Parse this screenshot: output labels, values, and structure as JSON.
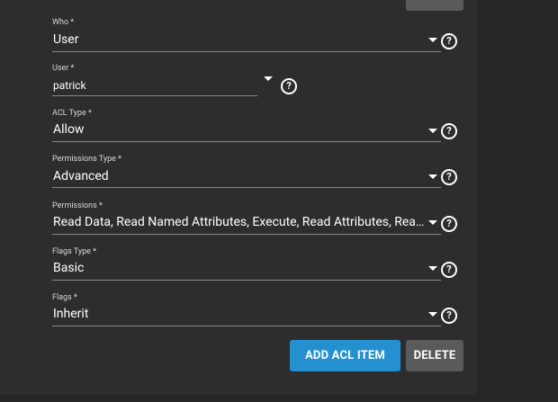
{
  "fields": [
    {
      "label": "Who *",
      "value": "User"
    },
    {
      "label": "User *",
      "value": "patrick"
    },
    {
      "label": "ACL Type *",
      "value": "Allow"
    },
    {
      "label": "Permissions Type *",
      "value": "Advanced"
    },
    {
      "label": "Permissions *",
      "value": "Read Data, Read Named Attributes, Execute, Read Attributes, Rea…"
    },
    {
      "label": "Flags Type *",
      "value": "Basic"
    },
    {
      "label": "Flags *",
      "value": "Inherit"
    }
  ],
  "help_glyph": "?",
  "buttons": {
    "add_acl_item": "ADD ACL ITEM",
    "delete": "DELETE"
  },
  "icons": {
    "dropdown": "chevron-down-icon",
    "help": "help-circle-icon"
  }
}
